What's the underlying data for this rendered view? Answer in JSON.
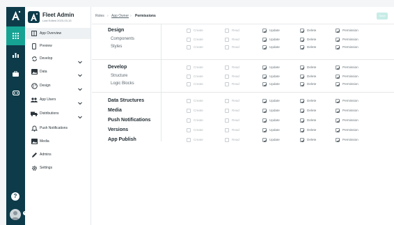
{
  "rail": {
    "items": [
      {
        "icon": "grid-icon",
        "active": true
      },
      {
        "icon": "bar-chart-icon",
        "active": false
      },
      {
        "icon": "briefcase-icon",
        "active": false
      },
      {
        "icon": "vr-headset-icon",
        "active": false
      }
    ],
    "help": "?",
    "collapse": "‹"
  },
  "sidebar": {
    "app_title": "Fleet Admin",
    "app_subtitle": "Last Edited 2023-03-15",
    "items": [
      {
        "label": "App Overview",
        "icon": "book-icon",
        "chevron": false,
        "active": true
      },
      {
        "label": "Preview",
        "icon": "phone-icon",
        "chevron": false,
        "active": false
      },
      {
        "label": "Develop",
        "icon": "sync-icon",
        "chevron": true,
        "active": false
      },
      {
        "label": "Data",
        "icon": "image-icon",
        "chevron": true,
        "active": false
      },
      {
        "label": "Design",
        "icon": "palette-icon",
        "chevron": true,
        "active": false
      },
      {
        "label": "App Users",
        "icon": "users-icon",
        "chevron": true,
        "active": false
      },
      {
        "label": "Distributions",
        "icon": "truck-icon",
        "chevron": true,
        "active": false
      },
      {
        "label": "Push Notifications",
        "icon": "bell-icon",
        "chevron": false,
        "active": false
      },
      {
        "label": "Media",
        "icon": "media-icon",
        "chevron": false,
        "active": false
      },
      {
        "label": "Admins",
        "icon": "pen-icon",
        "chevron": false,
        "active": false
      },
      {
        "label": "Settings",
        "icon": "gear-icon",
        "chevron": false,
        "active": false
      }
    ],
    "collapse": "‹"
  },
  "breadcrumb": {
    "items": [
      "Roles",
      "App Owner",
      "Permissions"
    ],
    "separator": "›"
  },
  "toolbar": {
    "save_label": "Save"
  },
  "permission_labels": [
    "Create",
    "Read",
    "Update",
    "Delete",
    "Permission"
  ],
  "permissions": [
    {
      "label": "Design",
      "level": "head",
      "checked": [
        false,
        false,
        true,
        true,
        true
      ]
    },
    {
      "label": "Components",
      "level": "sub",
      "checked": [
        false,
        false,
        true,
        true,
        true
      ]
    },
    {
      "label": "Styles",
      "level": "sub",
      "checked": [
        false,
        false,
        true,
        true,
        true
      ]
    },
    {
      "label": "Develop",
      "level": "head",
      "checked": [
        false,
        false,
        true,
        true,
        true
      ]
    },
    {
      "label": "Structure",
      "level": "sub",
      "checked": [
        false,
        false,
        true,
        true,
        true
      ]
    },
    {
      "label": "Logic Blocks",
      "level": "sub",
      "checked": [
        false,
        false,
        true,
        true,
        true
      ]
    },
    {
      "label": "Data Structures",
      "level": "head",
      "checked": [
        false,
        false,
        true,
        true,
        true
      ]
    },
    {
      "label": "Media",
      "level": "head",
      "checked": [
        false,
        false,
        true,
        true,
        true
      ]
    },
    {
      "label": "Push Notifications",
      "level": "head",
      "checked": [
        false,
        false,
        true,
        true,
        true
      ]
    },
    {
      "label": "Versions",
      "level": "head",
      "checked": [
        false,
        false,
        true,
        true,
        true
      ]
    },
    {
      "label": "App Publish",
      "level": "head",
      "checked": [
        false,
        false,
        true,
        true,
        true
      ]
    }
  ],
  "colors": {
    "rail": "#0d3b4a",
    "accent": "#16a394",
    "save": "#c8ece7"
  }
}
